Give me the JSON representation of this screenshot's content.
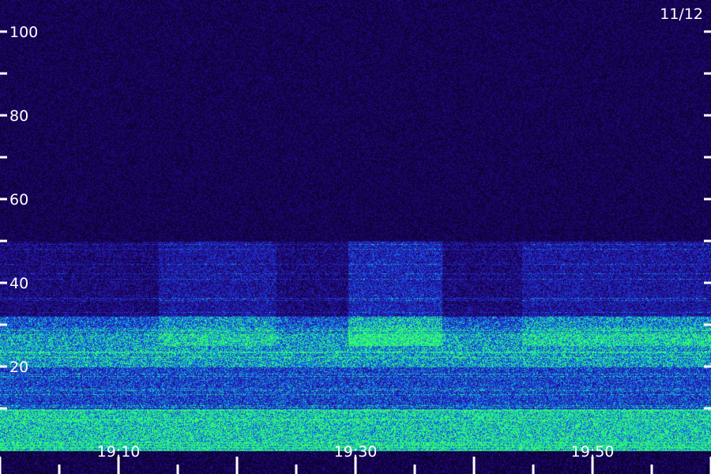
{
  "date_label": "11/12",
  "chart_data": {
    "type": "heatmap",
    "title": "",
    "xlabel": "",
    "ylabel": "",
    "x_ticks": [
      "19:10",
      "19:30",
      "19:50"
    ],
    "y_ticks": [
      20,
      40,
      60,
      80,
      100
    ],
    "ylim": [
      0,
      100
    ],
    "y_minor_step": 10,
    "x_range_minutes": [
      19.0,
      20.0
    ],
    "colors": {
      "background_noise": "#24107a",
      "mid_intensity": "#2a4dd8",
      "high_intensity": "#18e0b8",
      "peak": "#30ff80"
    },
    "bands": [
      {
        "freq_low": 0,
        "freq_high": 10,
        "intensity": 0.85
      },
      {
        "freq_low": 10,
        "freq_high": 20,
        "intensity": 0.55
      },
      {
        "freq_low": 20,
        "freq_high": 28,
        "intensity": 0.75
      },
      {
        "freq_low": 28,
        "freq_high": 32,
        "intensity": 0.6
      },
      {
        "freq_low": 32,
        "freq_high": 50,
        "intensity": 0.25
      }
    ]
  }
}
